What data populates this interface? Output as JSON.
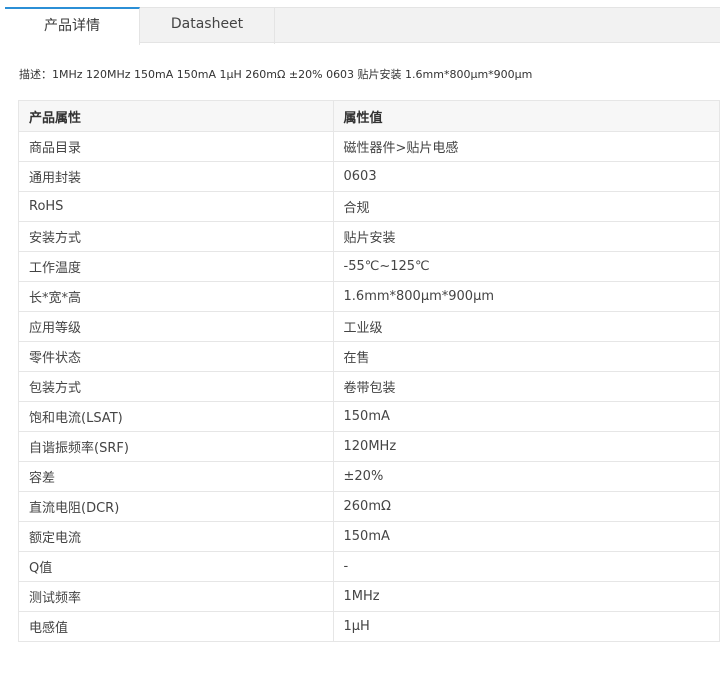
{
  "tabs": [
    {
      "label": "产品详情",
      "active": true
    },
    {
      "label": "Datasheet",
      "active": false
    }
  ],
  "description": "描述：1MHz 120MHz 150mA 150mA 1μH 260mΩ ±20% 0603 贴片安装 1.6mm*800μm*900μm",
  "table": {
    "headers": [
      "产品属性",
      "属性值"
    ],
    "rows": [
      {
        "name": "商品目录",
        "value": "磁性器件>贴片电感"
      },
      {
        "name": "通用封装",
        "value": "0603"
      },
      {
        "name": "RoHS",
        "value": "合规"
      },
      {
        "name": "安装方式",
        "value": "贴片安装"
      },
      {
        "name": "工作温度",
        "value": "-55℃~125℃"
      },
      {
        "name": "长*宽*高",
        "value": "1.6mm*800μm*900μm"
      },
      {
        "name": "应用等级",
        "value": "工业级"
      },
      {
        "name": "零件状态",
        "value": "在售"
      },
      {
        "name": "包装方式",
        "value": "卷带包装"
      },
      {
        "name": "饱和电流(LSAT)",
        "value": "150mA"
      },
      {
        "name": "自谐振频率(SRF)",
        "value": "120MHz"
      },
      {
        "name": "容差",
        "value": "±20%"
      },
      {
        "name": "直流电阻(DCR)",
        "value": "260mΩ"
      },
      {
        "name": "额定电流",
        "value": "150mA"
      },
      {
        "name": "Q值",
        "value": "-"
      },
      {
        "name": "测试频率",
        "value": "1MHz"
      },
      {
        "name": "电感值",
        "value": "1μH"
      }
    ]
  },
  "colors": {
    "accent": "#2b8fd6",
    "tabbar_bg": "#f2f2f2",
    "header_bg": "#f7f7f7",
    "border": "#e6e6e6"
  }
}
